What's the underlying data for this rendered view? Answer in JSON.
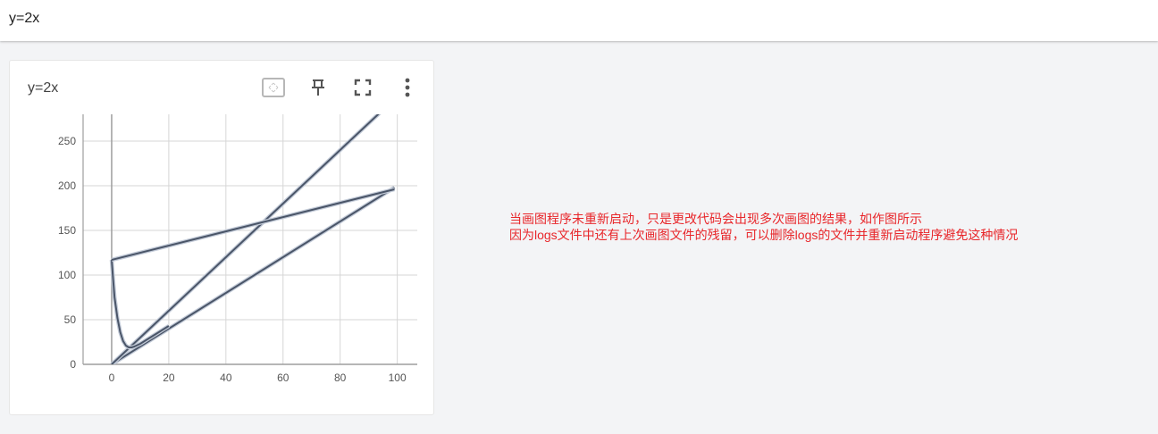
{
  "header": {
    "title": "y=2x"
  },
  "card": {
    "title": "y=2x",
    "icons": [
      "fit-domain-icon",
      "pin-icon",
      "fullscreen-icon",
      "more-vert-icon"
    ]
  },
  "annotation": {
    "lines": [
      "当画图程序未重新启动，只是更改代码会出现多次画图的结果，如作图所示",
      "因为logs文件中还有上次画图文件的残留，可以删除logs的文件并重新启动程序避免这种情况"
    ],
    "color": "#e8262a"
  },
  "chart_data": {
    "type": "line",
    "title": "",
    "xlabel": "",
    "ylabel": "",
    "xlim": [
      -10,
      107
    ],
    "ylim": [
      0,
      280
    ],
    "x_ticks": [
      0,
      20,
      40,
      60,
      80,
      100
    ],
    "y_ticks": [
      0,
      50,
      100,
      150,
      200,
      250
    ],
    "grid": true,
    "series_color": "#4a5568",
    "series": [
      {
        "x": [
          0,
          99
        ],
        "y": [
          0,
          198
        ]
      },
      {
        "x": [
          0,
          95
        ],
        "y": [
          0,
          285
        ]
      },
      {
        "x": [
          0,
          0.5,
          1,
          2,
          3,
          4,
          5,
          6,
          7,
          8,
          10,
          13,
          16,
          20
        ],
        "y": [
          117,
          95,
          75,
          52,
          36,
          26,
          21,
          19,
          19,
          20,
          23,
          29,
          35,
          43
        ]
      },
      {
        "x": [
          0,
          99
        ],
        "y": [
          117,
          196
        ]
      }
    ]
  }
}
